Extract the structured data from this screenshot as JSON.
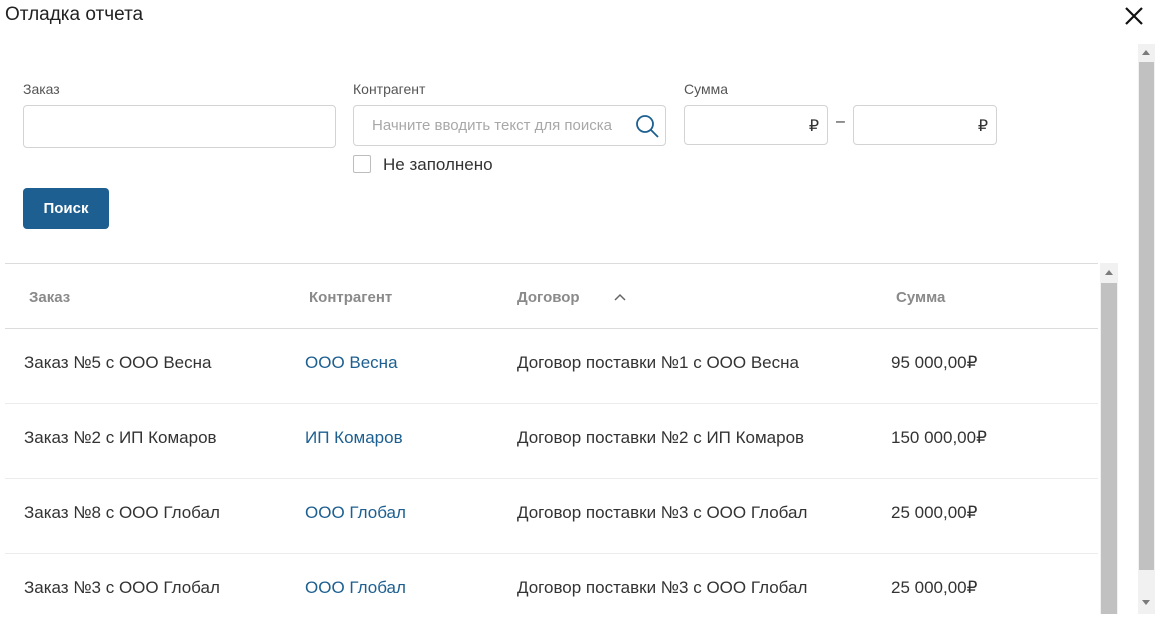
{
  "dialog": {
    "title": "Отладка отчета"
  },
  "filters": {
    "order_label": "Заказ",
    "order_value": "",
    "counterparty_label": "Контрагент",
    "counterparty_placeholder": "Начните вводить текст для поиска",
    "sum_label": "Сумма",
    "sum_from": "",
    "sum_to": "",
    "currency": "₽",
    "range_separator": "–",
    "empty_checkbox_label": "Не заполнено",
    "empty_checked": false,
    "search_button": "Поиск"
  },
  "table": {
    "columns": [
      "Заказ",
      "Контрагент",
      "Договор",
      "Сумма"
    ],
    "sorted_column": "Договор",
    "sort_direction": "ascending",
    "rows": [
      {
        "order": "Заказ №5 с ООО Весна",
        "counterparty": "ООО Весна",
        "contract": "Договор поставки №1 с ООО Весна",
        "sum": "95 000,00₽"
      },
      {
        "order": "Заказ №2 с ИП Комаров",
        "counterparty": "ИП Комаров",
        "contract": "Договор поставки №2 с ИП Комаров",
        "sum": "150 000,00₽"
      },
      {
        "order": "Заказ №8 с ООО Глобал",
        "counterparty": "ООО Глобал",
        "contract": "Договор поставки №3 с ООО Глобал",
        "sum": "25 000,00₽"
      },
      {
        "order": "Заказ №3 с ООО Глобал",
        "counterparty": "ООО Глобал",
        "contract": "Договор поставки №3 с ООО Глобал",
        "sum": "25 000,00₽"
      }
    ]
  },
  "colors": {
    "primary": "#1c5f90",
    "link": "#1c5f90"
  }
}
